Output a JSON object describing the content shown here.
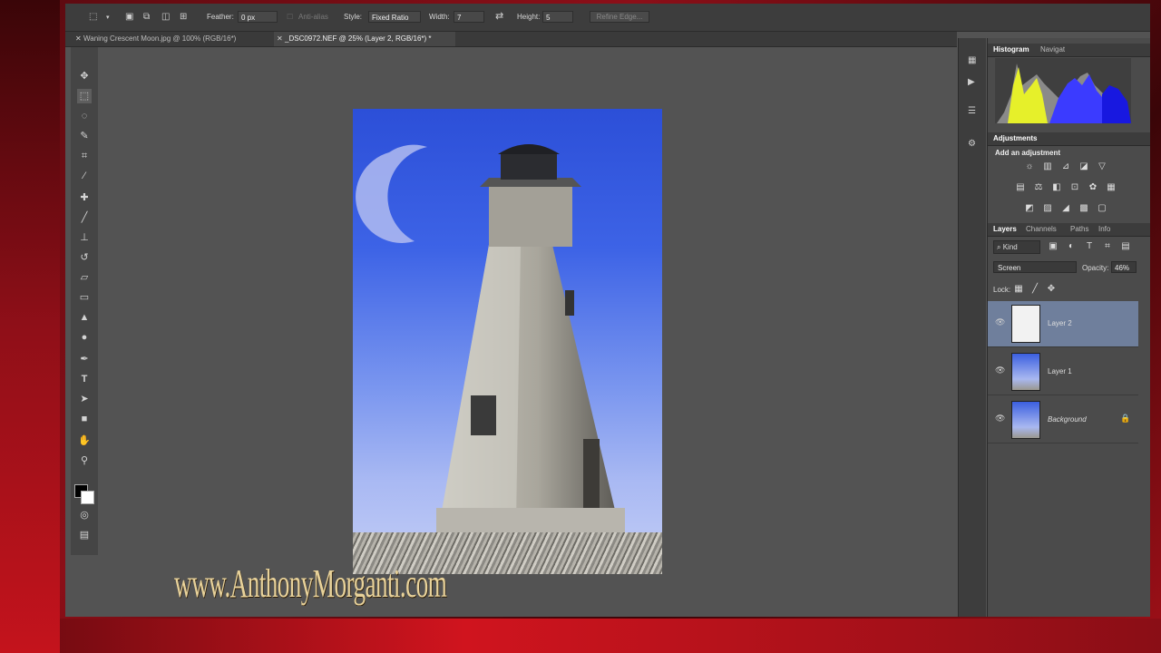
{
  "options_bar": {
    "feather_label": "Feather:",
    "feather_value": "0 px",
    "antialias_label": "Anti-alias",
    "style_label": "Style:",
    "style_value": "Fixed Ratio",
    "width_label": "Width:",
    "width_value": "7",
    "height_label": "Height:",
    "height_value": "5",
    "refine_edge": "Refine Edge..."
  },
  "tabs": [
    {
      "label": "Waning Crescent Moon.jpg @ 100% (RGB/16*)"
    },
    {
      "label": "_DSC0972.NEF @ 25% (Layer 2, RGB/16*) *"
    }
  ],
  "panels": {
    "histogram_tab": "Histogram",
    "navigator_tab": "Navigat",
    "adjustments_title": "Adjustments",
    "add_adjustment": "Add an adjustment",
    "layers_tabs": [
      "Layers",
      "Channels",
      "Paths",
      "Info"
    ],
    "kind_label": "Kind",
    "blend_mode": "Screen",
    "opacity_label": "Opacity:",
    "opacity_value": "46%",
    "lock_label": "Lock:"
  },
  "layers": [
    {
      "name": "Layer 2",
      "selected": true
    },
    {
      "name": "Layer 1",
      "selected": false
    },
    {
      "name": "Background",
      "selected": false,
      "locked": true
    }
  ],
  "watermark": "www.AnthonyMorganti.com",
  "colors": {
    "accent_red": "#c8141e",
    "selected_layer": "#6f7f9c",
    "sky_blue": "#3d63e6"
  }
}
